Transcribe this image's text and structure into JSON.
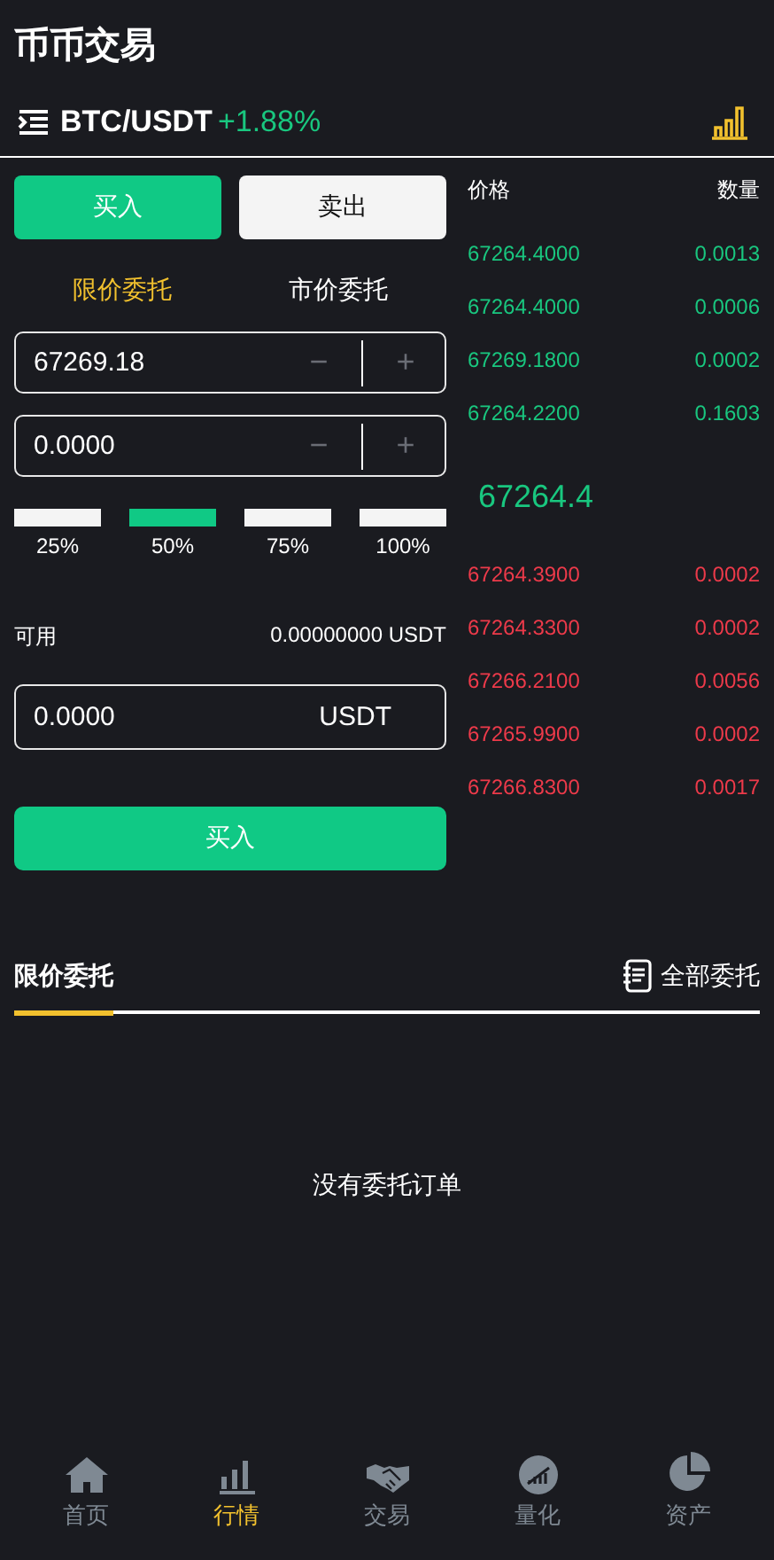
{
  "header": {
    "title": "币币交易"
  },
  "pair": {
    "symbol": "BTC/USDT",
    "change": "+1.88%"
  },
  "side_tabs": [
    {
      "label": "买入",
      "selected": true
    },
    {
      "label": "卖出",
      "selected": false
    }
  ],
  "order_types": [
    {
      "label": "限价委托",
      "selected": true
    },
    {
      "label": "市价委托",
      "selected": false
    }
  ],
  "price_field": {
    "value": "67269.18",
    "minus": "−",
    "plus": "+"
  },
  "amount_field": {
    "value": "0.0000",
    "minus": "−",
    "plus": "+"
  },
  "percent_buttons": [
    {
      "label": "25%",
      "selected": false
    },
    {
      "label": "50%",
      "selected": true
    },
    {
      "label": "75%",
      "selected": false
    },
    {
      "label": "100%",
      "selected": false
    }
  ],
  "available": {
    "label": "可用",
    "value": "0.00000000 USDT"
  },
  "total_field": {
    "value": "0.0000",
    "unit": "USDT"
  },
  "submit": "买入",
  "order_book": {
    "columns": [
      "价格",
      "数量"
    ],
    "bids": [
      {
        "price": "67264.4000",
        "amount": "0.0013"
      },
      {
        "price": "67264.4000",
        "amount": "0.0006"
      },
      {
        "price": "67269.1800",
        "amount": "0.0002"
      },
      {
        "price": "67264.2200",
        "amount": "0.1603"
      }
    ],
    "last_price": "67264.4",
    "asks": [
      {
        "price": "67264.3900",
        "amount": "0.0002"
      },
      {
        "price": "67264.3300",
        "amount": "0.0002"
      },
      {
        "price": "67266.2100",
        "amount": "0.0056"
      },
      {
        "price": "67265.9900",
        "amount": "0.0002"
      },
      {
        "price": "67266.8300",
        "amount": "0.0017"
      }
    ]
  },
  "orders": {
    "tab": "限价委托",
    "all_link": "全部委托",
    "empty": "没有委托订单"
  },
  "nav": [
    {
      "label": "首页",
      "kind": "home",
      "selected": false
    },
    {
      "label": "行情",
      "kind": "chart",
      "selected": true
    },
    {
      "label": "交易",
      "kind": "handshake",
      "selected": false
    },
    {
      "label": "量化",
      "kind": "quant",
      "selected": false
    },
    {
      "label": "资产",
      "kind": "pie",
      "selected": false
    }
  ]
}
